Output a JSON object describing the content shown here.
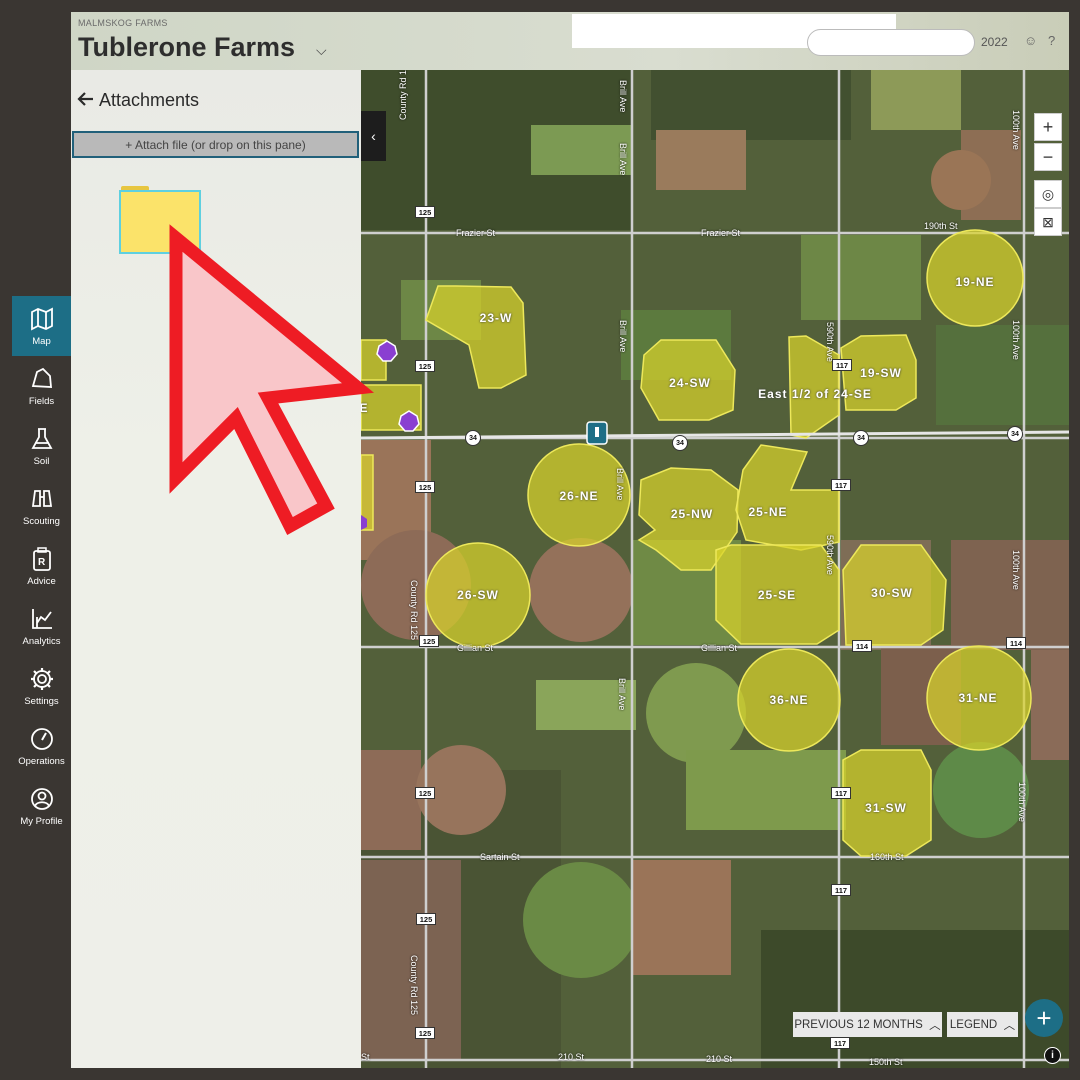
{
  "header": {
    "org_name": "MALMSKOG FARMS",
    "farm_title": "Tublerone Farms",
    "year": "2022",
    "caret": "⌵",
    "smile_glyph": "☺",
    "help_glyph": "?"
  },
  "nav": {
    "items": [
      {
        "label": "Map",
        "icon": "map-icon",
        "active": true
      },
      {
        "label": "Fields",
        "icon": "fields-icon"
      },
      {
        "label": "Soil",
        "icon": "flask-icon"
      },
      {
        "label": "Scouting",
        "icon": "binoculars-icon"
      },
      {
        "label": "Advice",
        "icon": "prescription-icon"
      },
      {
        "label": "Analytics",
        "icon": "chart-icon"
      },
      {
        "label": "Settings",
        "icon": "gear-icon"
      },
      {
        "label": "Operations",
        "icon": "gauge-icon"
      },
      {
        "label": "My Profile",
        "icon": "user-icon"
      }
    ]
  },
  "pane": {
    "title": "Attachments",
    "back_glyph": "🡐",
    "attach_label": "+  Attach file (or drop on this pane)"
  },
  "map": {
    "fields": [
      {
        "label": "23-W"
      },
      {
        "label": "24-SW"
      },
      {
        "label": "East 1/2 of 24-SE"
      },
      {
        "label": "19-SW"
      },
      {
        "label": "19-NE"
      },
      {
        "label": "26-NE"
      },
      {
        "label": "25-NW"
      },
      {
        "label": "25-NE"
      },
      {
        "label": "26-SW"
      },
      {
        "label": "25-SE"
      },
      {
        "label": "30-SW"
      },
      {
        "label": "36-NE"
      },
      {
        "label": "31-NE"
      },
      {
        "label": "31-SW"
      },
      {
        "label": "E"
      }
    ],
    "roads": [
      "Frazier St",
      "Frazier St",
      "190th St",
      "Gillian St",
      "Gillian St",
      "Sartain St",
      "160th St",
      "210 St",
      "210 St",
      "150th St",
      "County Rd 125",
      "County Rd 125",
      "County Rd 125",
      "Brill Ave",
      "Brill Ave",
      "Brill Ave",
      "Brill Ave",
      "Brill Ave",
      "590th Ave",
      "590th Ave",
      "100th Ave",
      "100th Ave",
      "100th Ave",
      "100th Ave",
      "St"
    ],
    "shields": [
      "125",
      "125",
      "125",
      "125",
      "125",
      "125",
      "125",
      "117",
      "117",
      "117",
      "117",
      "117",
      "114",
      "114"
    ],
    "hwy": [
      "34",
      "34",
      "34",
      "34"
    ],
    "controls": {
      "zoom_in": "+",
      "zoom_out": "−",
      "locate_glyph": "◎",
      "layers_glyph": "⊠"
    },
    "prev_label": "PREVIOUS 12 MONTHS",
    "legend_label": "LEGEND",
    "fab_label": "+",
    "info_label": "i",
    "collapse_glyph": "‹"
  }
}
